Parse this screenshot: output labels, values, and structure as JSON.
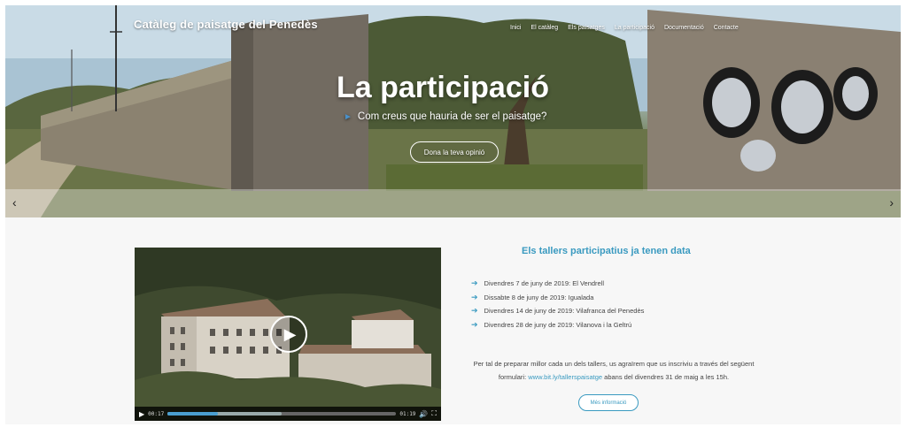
{
  "header": {
    "brand": "Catàleg de paisatge del Penedès",
    "nav": [
      "Inici",
      "El catàleg",
      "Els paisatges",
      "La participació",
      "Documentació",
      "Contacte"
    ]
  },
  "hero": {
    "title": "La participació",
    "subtitle": "Com creus que hauria de ser el paisatge?",
    "button": "Dona la teva opinió",
    "prev_icon": "chevron-left-icon",
    "next_icon": "chevron-right-icon"
  },
  "video": {
    "current_time": "00:17",
    "duration": "01:19",
    "progress": 0.22,
    "buffered": 0.5,
    "play_icon": "play-icon",
    "volume_icon": "volume-icon",
    "fullscreen_icon": "fullscreen-icon"
  },
  "workshops": {
    "title": "Els tallers participatius ja tenen data",
    "items": [
      "Divendres 7 de juny de 2019: El Vendrell",
      "Dissabte 8 de juny de 2019: Igualada",
      "Divendres 14 de juny de 2019: Vilafranca del Penedès",
      "Divendres 28 de juny de 2019: Vilanova i la Geltrú"
    ],
    "paragraph_before": "Per tal de preparar millor cada un dels tallers, us agraïrem que us inscriviu a través del següent formulari:",
    "link": "www.bit.ly/tallerspaisatge",
    "paragraph_after": "abans del divendres 31 de maig a les 15h.",
    "more_button": "Més informació"
  },
  "colors": {
    "accent": "#3a9ac0",
    "progress": "#4a9fd0"
  }
}
